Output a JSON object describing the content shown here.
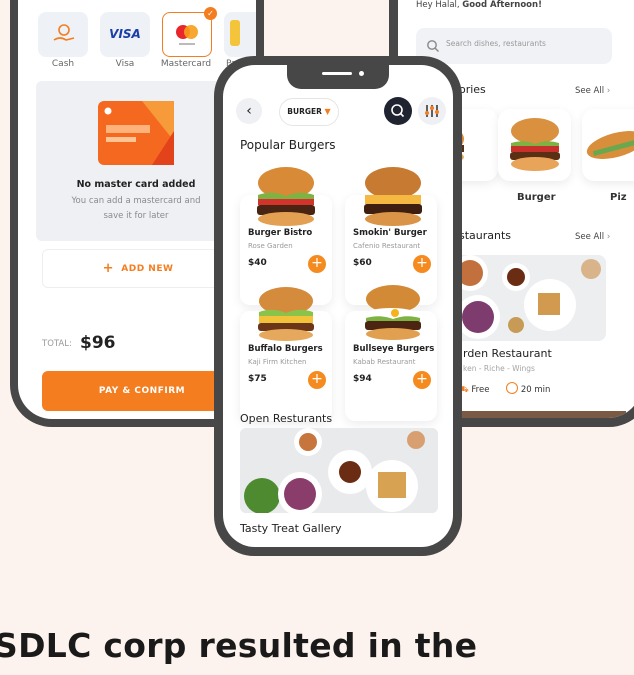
{
  "left": {
    "payment_methods": [
      {
        "label": "Cash"
      },
      {
        "label": "Visa",
        "brand_text": "VISA"
      },
      {
        "label": "Mastercard"
      },
      {
        "label": "Pa"
      }
    ],
    "empty_title": "No master card added",
    "empty_sub_1": "You can add a mastercard and",
    "empty_sub_2": "save it for later",
    "add_new": "ADD NEW",
    "total_label": "TOTAL:",
    "total_value": "$96",
    "pay_confirm": "PAY & CONFIRM"
  },
  "right": {
    "greeting": "Hey Halal, ",
    "greeting_bold": "Good Afternoon!",
    "search_placeholder": "Search dishes, restaurants",
    "categories_title": "gories",
    "see_all": "See All",
    "category_burger": "Burger",
    "category_partial": "Piz",
    "restaurants_title": "staurants",
    "restaurant_name": "rden Restaurant",
    "restaurant_tags": "ken - Riche - Wings",
    "delivery": "Free",
    "time": "20 min"
  },
  "center": {
    "filter_label": "BURGER",
    "section_title": "Popular Burgers",
    "products": [
      {
        "name": "Burger Bistro",
        "place": "Rose Garden",
        "price": "$40"
      },
      {
        "name": "Smokin' Burger",
        "place": "Cafenio Restaurant",
        "price": "$60"
      },
      {
        "name": "Buffalo Burgers",
        "place": "Kaji Firm Kitchen",
        "price": "$75"
      },
      {
        "name": "Bullseye Burgers",
        "place": "Kabab Restaurant",
        "price": "$94"
      }
    ],
    "open_title": "Open Resturants",
    "restaurant_name": "Tasty Treat Gallery"
  },
  "headline": "SDLC corp resulted in the",
  "colors": {
    "accent": "#f47d20",
    "frame": "#474747",
    "background": "#fdf3ee"
  }
}
